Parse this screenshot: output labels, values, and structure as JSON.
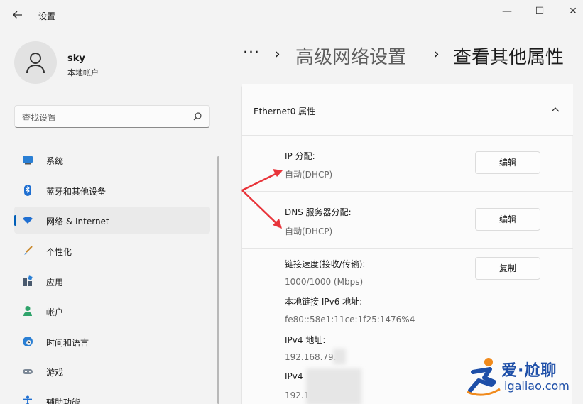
{
  "window": {
    "title": "设置",
    "minimize_glyph": "—",
    "maximize_glyph": "☐",
    "close_glyph": "✕"
  },
  "profile": {
    "name": "sky",
    "account_type": "本地帐户"
  },
  "search": {
    "placeholder": "查找设置"
  },
  "sidebar": {
    "items": [
      {
        "label": "系统",
        "icon": "monitor-icon",
        "active": false
      },
      {
        "label": "蓝牙和其他设备",
        "icon": "bluetooth-icon",
        "active": false
      },
      {
        "label": "网络 & Internet",
        "icon": "wifi-icon",
        "active": true
      },
      {
        "label": "个性化",
        "icon": "brush-icon",
        "active": false
      },
      {
        "label": "应用",
        "icon": "apps-icon",
        "active": false
      },
      {
        "label": "帐户",
        "icon": "person-icon",
        "active": false
      },
      {
        "label": "时间和语言",
        "icon": "globe-clock-icon",
        "active": false
      },
      {
        "label": "游戏",
        "icon": "gamepad-icon",
        "active": false
      },
      {
        "label": "辅助功能",
        "icon": "accessibility-icon",
        "active": false
      }
    ]
  },
  "breadcrumb": {
    "dots": "···",
    "sep": "›",
    "parent": "高级网络设置",
    "current": "查看其他属性"
  },
  "card": {
    "title": "Ethernet0 属性",
    "ip_assignment": {
      "label": "IP 分配:",
      "value": "自动(DHCP)",
      "button": "编辑"
    },
    "dns_assignment": {
      "label": "DNS 服务器分配:",
      "value": "自动(DHCP)",
      "button": "编辑"
    },
    "properties": {
      "link_speed_label": "链接速度(接收/传输):",
      "link_speed_value": "1000/1000 (Mbps)",
      "ipv6_label": "本地链接 IPv6 地址:",
      "ipv6_value": "fe80::58e1:11ce:1f25:1476%4",
      "ipv4_label": "IPv4 地址:",
      "ipv4_value": "192.168.79.",
      "ipv4_2_label": "IPv4",
      "ipv4_2_value": "192.1",
      "copy_button": "复制"
    }
  },
  "watermark": {
    "line1": "爱·尬聊",
    "line2": "igaliao.com"
  },
  "colors": {
    "accent": "#005fb8",
    "arrow": "#e8343a",
    "watermark_blue": "#1e4fa8",
    "watermark_orange": "#f08a1c"
  }
}
